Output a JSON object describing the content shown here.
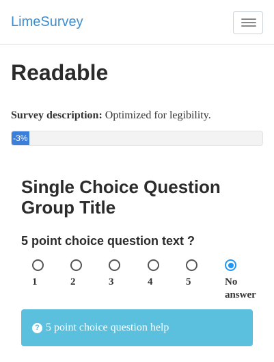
{
  "navbar": {
    "brand": "LimeSurvey",
    "menu_icon": "hamburger-menu-icon"
  },
  "survey": {
    "title": "Readable",
    "description_label": "Survey description:",
    "description_text": "Optimized for legibility."
  },
  "progress": {
    "label": "-3%",
    "fill_percent": 7
  },
  "group": {
    "title": "Single Choice Question Group Title"
  },
  "question": {
    "text": "5 point choice question text ?",
    "options": [
      {
        "label_line1": "1",
        "label_line2": "",
        "selected": false
      },
      {
        "label_line1": "2",
        "label_line2": "",
        "selected": false
      },
      {
        "label_line1": "3",
        "label_line2": "",
        "selected": false
      },
      {
        "label_line1": "4",
        "label_line2": "",
        "selected": false
      },
      {
        "label_line1": "5",
        "label_line2": "",
        "selected": false
      },
      {
        "label_line1": "No",
        "label_line2": "answer",
        "selected": true
      }
    ],
    "help_icon": "question-circle-icon",
    "help_text": "5 point choice question help"
  },
  "colors": {
    "brand": "#3c8dcf",
    "progress_fill": "#3c7fd9",
    "radio_selected": "#2196f3",
    "help_background": "#5bc0de"
  }
}
